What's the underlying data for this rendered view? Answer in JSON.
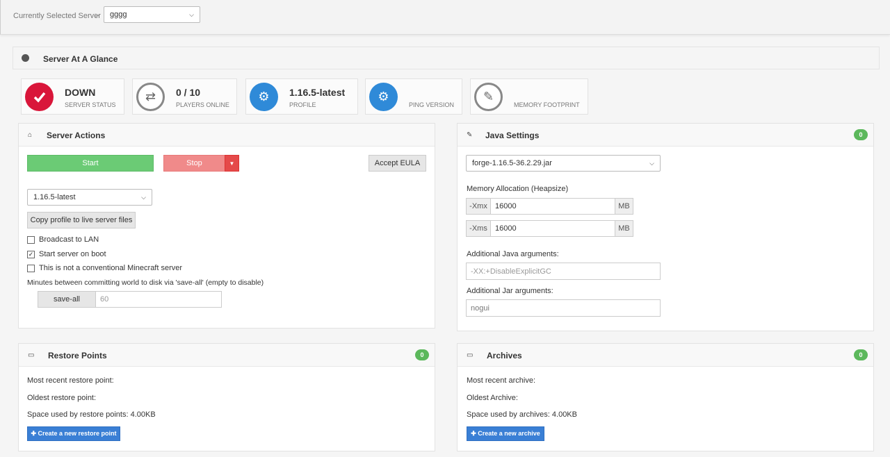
{
  "topbar": {
    "crumb_label": "Currently Selected Server",
    "crumb_sep": ">",
    "server_select_value": "gggg"
  },
  "glance": {
    "title": "Server At A Glance",
    "stats": [
      {
        "value": "DOWN",
        "label": "SERVER STATUS",
        "icon": "checkmark-icon",
        "color": "#d9163a"
      },
      {
        "value": "0 / 10",
        "label": "PLAYERS ONLINE",
        "icon": "swap-arrows-icon"
      },
      {
        "value": "1.16.5-latest",
        "label": "PROFILE",
        "icon": "gears-icon",
        "color": "#2f8ad8"
      },
      {
        "value": "",
        "label": "PING VERSION",
        "icon": "gears-icon",
        "color": "#2f8ad8"
      },
      {
        "value": "",
        "label": "MEMORY FOOTPRINT",
        "icon": "ticket-icon"
      }
    ]
  },
  "actions": {
    "title": "Server Actions",
    "start_label": "Start",
    "stop_label": "Stop",
    "eula_label": "Accept EULA",
    "profile_select_value": "1.16.5-latest",
    "copy_profile_label": "Copy profile to live server files",
    "broadcast_label": "Broadcast to LAN",
    "broadcast_checked": false,
    "boot_label": "Start server on boot",
    "boot_checked": true,
    "nonstandard_label": "This is not a conventional Minecraft server",
    "nonstandard_checked": false,
    "saveall_note": "Minutes between committing world to disk via 'save-all' (empty to disable)",
    "saveall_button": "save-all",
    "saveall_placeholder": "60"
  },
  "java": {
    "title": "Java Settings",
    "badge": "0",
    "jar_select_value": "forge-1.16.5-36.2.29.jar",
    "memory_label": "Memory Allocation (Heapsize)",
    "xmx_prefix": "-Xmx",
    "xmx_value": "16000",
    "xmx_unit": "MB",
    "xms_prefix": "-Xms",
    "xms_value": "16000",
    "xms_unit": "MB",
    "java_args_label": "Additional Java arguments:",
    "java_args_placeholder": "-XX:+DisableExplicitGC",
    "jar_args_label": "Additional Jar arguments:",
    "jar_args_value": "nogui"
  },
  "restore": {
    "title": "Restore Points",
    "badge": "0",
    "recent": "Most recent restore point:",
    "oldest": "Oldest restore point:",
    "space": "Space used by restore points: 4.00KB",
    "create_label": "✚ Create a new restore point"
  },
  "archives": {
    "title": "Archives",
    "badge": "0",
    "recent": "Most recent archive:",
    "oldest": "Oldest Archive:",
    "space": "Space used by archives: 4.00KB",
    "create_label": "✚ Create a new archive"
  }
}
